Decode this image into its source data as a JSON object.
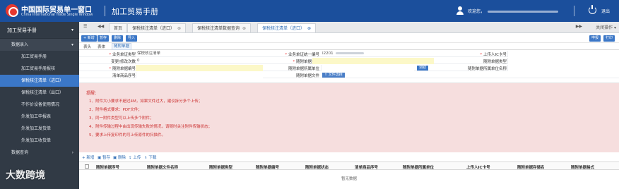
{
  "header": {
    "brand_cn": "中国国际贸易单一窗口",
    "brand_en": "China International Trade Single Window",
    "system_title": "加工贸易手册",
    "welcome": "欢迎您，",
    "logout": "退出"
  },
  "sidebar": {
    "top": "加工贸易手册",
    "section1": "数据录入",
    "items": [
      {
        "label": "加工贸易手册",
        "active": false
      },
      {
        "label": "加工贸易手册报核",
        "active": false
      },
      {
        "label": "保税核注清单（进口）",
        "active": true
      },
      {
        "label": "保税核注清单（出口）",
        "active": false
      },
      {
        "label": "不作价设备使用情况",
        "active": false
      },
      {
        "label": "外发加工申报表",
        "active": false
      },
      {
        "label": "外发加工发货单",
        "active": false
      },
      {
        "label": "外发加工收货单",
        "active": false
      }
    ],
    "section2": "数据查询"
  },
  "tabbar": {
    "menu": "☰",
    "back": "◀◀",
    "tabs": [
      {
        "label": "首页",
        "active": false,
        "closable": false
      },
      {
        "label": "保税核注清单（进口）",
        "active": false,
        "closable": true
      },
      {
        "label": "保税核注清单数据查询",
        "active": false,
        "closable": true
      },
      {
        "label": "保税核注清单（进口）",
        "active": true,
        "closable": true
      }
    ],
    "forward": "▶▶",
    "close_ops": "关闭操作 ▾"
  },
  "toolbar": {
    "new": "+ 新增",
    "save": "暂存",
    "delete": "删除",
    "import": "导入",
    "declare": "申报",
    "print": "打印"
  },
  "subtabs": [
    "表头",
    "表体",
    "随附单据"
  ],
  "form": {
    "row1": {
      "biz_type_label": "业务单证类型",
      "biz_type_value": "保税核注清单",
      "biz_no_label": "业务单证统一编号",
      "biz_no_value": "I2201",
      "ic_label": "上传人IC卡号"
    },
    "row2": {
      "change_count_label": "变更/修改次数",
      "change_count_value": "0",
      "attach_type_label": "随附单据类型"
    },
    "row3": {
      "attach_no_label": "随附单据编号",
      "attach_unit_label": "随附单据所属单位",
      "attach_unit_btn": "调取",
      "attach_unit_name_label": "随附单据所属单位名称"
    },
    "row4": {
      "list_item_label": "清单商品序号",
      "attach_file_label": "随附单据文件",
      "select_file_btn": "文件选择"
    }
  },
  "notice": {
    "title": "提醒：",
    "lines": [
      "1、附件大小要求不超过4M，如果文件过大，建议拆分多个上传；",
      "2、附件格式要求：PDF文件；",
      "3、同一附件类型可以上传多个附件；",
      "4、附件传输过程中由出现传输失败的情况，请随时关注附件传输状态；",
      "5、要求上传复印件的可上传原件的扫描件。"
    ]
  },
  "attach_toolbar": {
    "new": "+ 新增",
    "save": "暂存",
    "delete": "删除",
    "upload": "上传",
    "download": "下载"
  },
  "grid": {
    "columns": [
      "随附单据序号",
      "随附单据文件名称",
      "随附单据类型",
      "随附单据编号",
      "随附单据状态",
      "清单商品序号",
      "随附单据所属单位",
      "上传人IC卡号",
      "随附单据存储名",
      "随附单据格式"
    ],
    "empty_text": "暂无数据"
  },
  "watermark": "大数跨境"
}
